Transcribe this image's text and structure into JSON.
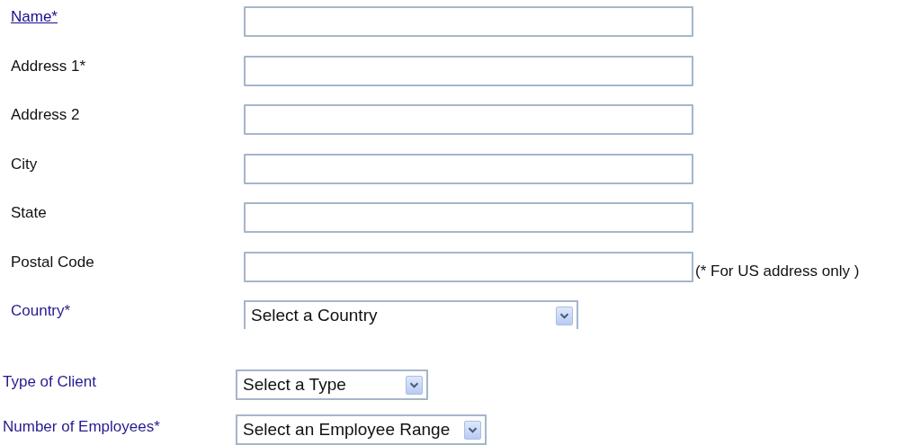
{
  "sections": [
    {
      "rows": [
        {
          "label": "Name*",
          "kind": "link",
          "field": {
            "kind": "text"
          }
        },
        {
          "label": "Address 1*",
          "kind": "plain",
          "field": {
            "kind": "text"
          }
        },
        {
          "label": "Address 2",
          "kind": "plain",
          "field": {
            "kind": "text"
          }
        },
        {
          "label": "City",
          "kind": "plain",
          "field": {
            "kind": "text"
          }
        },
        {
          "label": "State",
          "kind": "plain",
          "field": {
            "kind": "text"
          }
        },
        {
          "label": "Postal Code",
          "kind": "plain",
          "field": {
            "kind": "text"
          },
          "note": "(* For US address only )"
        },
        {
          "label": "Country*",
          "kind": "accent",
          "field": {
            "kind": "select",
            "value": "Select a Country"
          }
        }
      ]
    },
    {
      "rows": [
        {
          "label": "Type of Client",
          "kind": "accent",
          "field": {
            "kind": "select",
            "value": "Select a Type"
          }
        },
        {
          "label": "Number of Employees*",
          "kind": "accent",
          "field": {
            "kind": "select",
            "value": "Select an Employee Range"
          }
        }
      ]
    }
  ]
}
